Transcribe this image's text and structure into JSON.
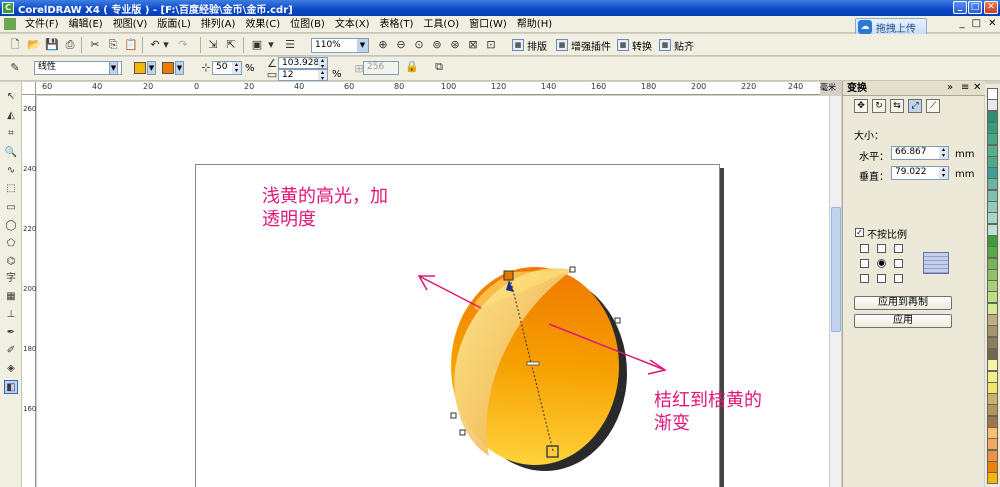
{
  "titlebar": {
    "title": "CorelDRAW X4 ( 专业版 ) - [F:\\百度经验\\金币\\金币.cdr]",
    "app_icon": "coreldraw-icon",
    "minimize": "_",
    "maximize": "□",
    "close": "✕"
  },
  "menubar": {
    "items": [
      "文件(F)",
      "编辑(E)",
      "视图(V)",
      "版面(L)",
      "排列(A)",
      "效果(C)",
      "位图(B)",
      "文本(X)",
      "表格(T)",
      "工具(O)",
      "窗口(W)",
      "帮助(H)"
    ]
  },
  "upload_button": {
    "label": "拖拽上传"
  },
  "doc_window_buttons": [
    "_",
    "□",
    "✕"
  ],
  "standard_toolbar": {
    "zoom": "110%",
    "plugins": [
      "排版",
      "增强插件",
      "转换",
      "贴齐"
    ]
  },
  "property_bar": {
    "fill_type": "线性",
    "fill_color_1": "#f7b500",
    "fill_color_2": "#f07800",
    "midpoint": "50",
    "midpoint_unit": "%",
    "angle": "103.928",
    "edge_pad": "12",
    "edge_unit": "%",
    "steps": "256"
  },
  "ruler": {
    "h_labels": [
      "60",
      "40",
      "20",
      "0",
      "20",
      "40",
      "60",
      "80",
      "100",
      "120",
      "140",
      "160",
      "180",
      "200",
      "220",
      "240"
    ],
    "unit": "毫米",
    "v_labels": [
      "260",
      "240",
      "220",
      "200",
      "180",
      "160"
    ]
  },
  "docker": {
    "title": "变换",
    "size_label": "大小：",
    "h_label": "水平：",
    "h_value": "66.867",
    "v_label": "垂直：",
    "v_value": "79.022",
    "unit": "mm",
    "proportional_label": "不按比例",
    "apply_duplicate": "应用到再制",
    "apply": "应用"
  },
  "annotations": {
    "highlight_text_line1": "浅黄的高光，加",
    "highlight_text_line2": "透明度",
    "gradient_text_line1": "桔红到桔黄的",
    "gradient_text_line2": "渐变"
  },
  "colors": {
    "accent_pink": "#e0157b",
    "coin_orange": "#f08000",
    "coin_yellow": "#ffd23a"
  },
  "palette": [
    "#ffffff",
    "#e8e8e8",
    "#2f8f6f",
    "#3a9a7a",
    "#4aa582",
    "#55b08a",
    "#4ea88f",
    "#3f9f96",
    "#6ab5a0",
    "#7fc0ac",
    "#93cbb8",
    "#a8d6c4",
    "#bde0d0",
    "#3c9b3c",
    "#58a84a",
    "#75b558",
    "#8fc266",
    "#a8cf76",
    "#c1dc86",
    "#d8e89a",
    "#bfae82",
    "#a3966c",
    "#8a7f59",
    "#706848",
    "#f6f6a5",
    "#f3ef86",
    "#efe667",
    "#c9b269",
    "#b3945a",
    "#9d774b",
    "#f7c073",
    "#f3a95a",
    "#ef9342",
    "#f08000",
    "#f7b500"
  ]
}
